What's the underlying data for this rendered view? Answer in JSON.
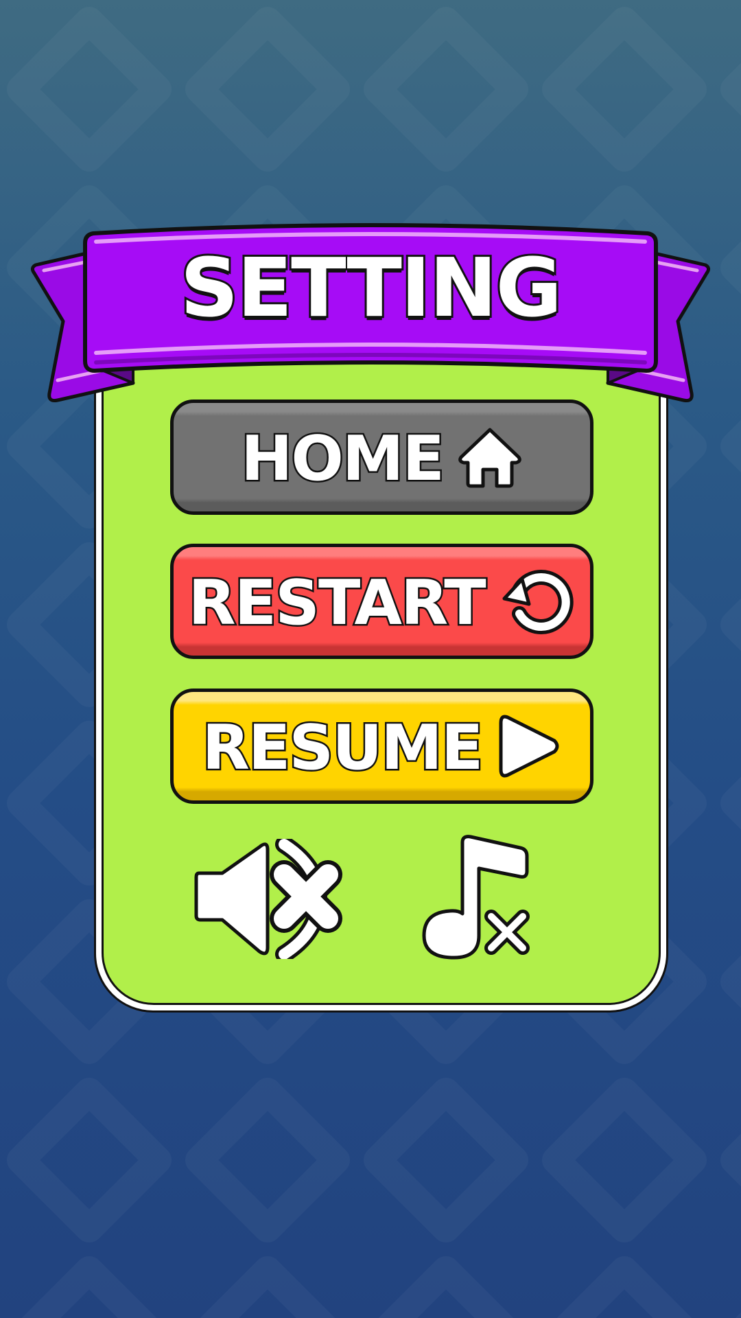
{
  "title": "SETTING",
  "buttons": {
    "home": {
      "label": "HOME",
      "icon": "home-icon",
      "color": "#727272"
    },
    "restart": {
      "label": "RESTART",
      "icon": "restart-icon",
      "color": "#fb4a4a"
    },
    "resume": {
      "label": "RESUME",
      "icon": "play-icon",
      "color": "#ffd400"
    }
  },
  "toggles": {
    "sound": {
      "icon": "sound-muted-icon",
      "state": "off"
    },
    "music": {
      "icon": "music-muted-icon",
      "state": "off"
    }
  },
  "colors": {
    "ribbon": "#a60cf6",
    "panel": "#b1ef4a",
    "background": "#244d86"
  }
}
